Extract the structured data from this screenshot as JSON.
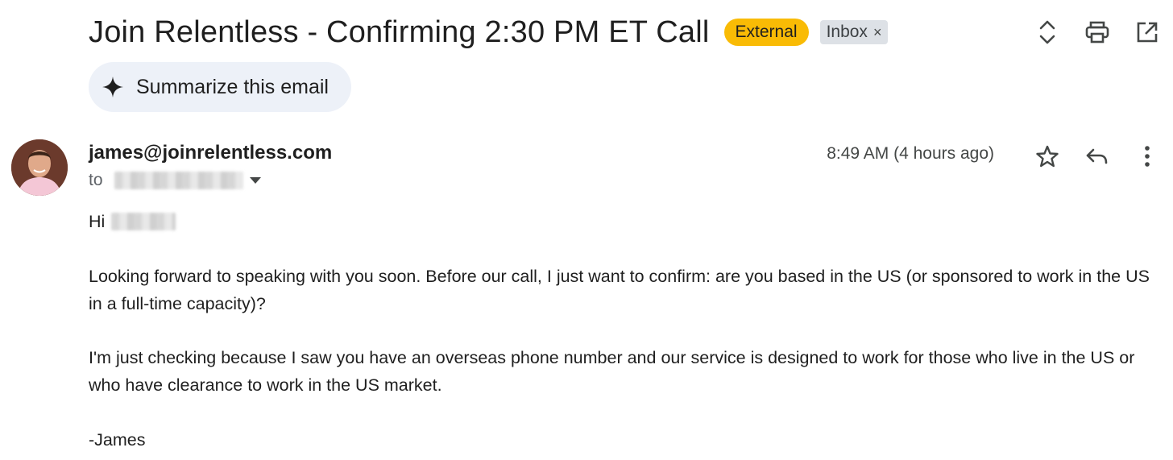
{
  "email": {
    "subject": "Join Relentless - Confirming 2:30 PM ET Call",
    "labels": {
      "external": "External",
      "inbox": "Inbox",
      "inbox_remove": "×"
    },
    "summarize_label": "Summarize this email",
    "sender": "james@joinrelentless.com",
    "to_prefix": "to",
    "timestamp": "8:49 AM (4 hours ago)",
    "greeting": "Hi",
    "body_paragraphs": [
      "Looking forward to speaking with you soon. Before our call, I just want to confirm: are you based in the US (or sponsored to work in the US in a full-time capacity)?",
      "I'm just checking because I saw you have an overseas phone number and our service is designed to work for those who live in the US or who have clearance to work in the US market."
    ],
    "signoff": "-James"
  },
  "icons": {
    "expand": "unfold-icon",
    "print": "print-icon",
    "open_new": "open-in-new-icon",
    "star": "star-icon",
    "reply": "reply-icon",
    "more": "more-vert-icon",
    "spark": "sparkle-icon",
    "dropdown": "dropdown-arrow-icon"
  },
  "colors": {
    "external_badge": "#f9bb05",
    "inbox_chip": "#dde1e6",
    "summarize_bg": "#edf1f8"
  }
}
